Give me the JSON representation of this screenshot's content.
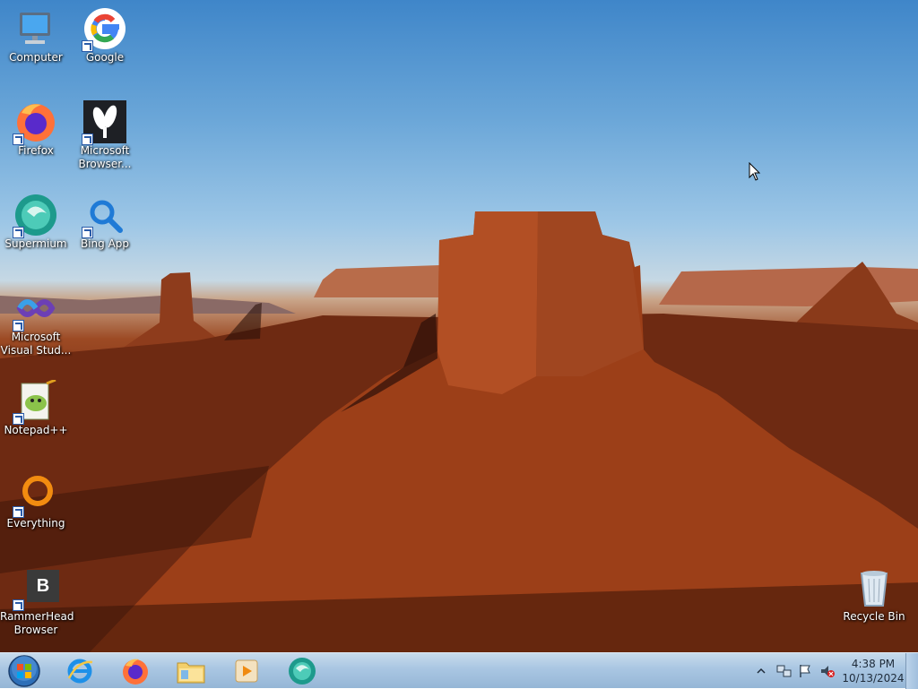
{
  "desktop": {
    "icons": [
      {
        "label": "Computer",
        "icon": "computer-icon"
      },
      {
        "label": "Google",
        "icon": "google-icon"
      },
      {
        "label": "Firefox",
        "icon": "firefox-icon"
      },
      {
        "label": "Microsoft Browser...",
        "icon": "microsoft-browser-icon"
      },
      {
        "label": "Supermium",
        "icon": "supermium-icon"
      },
      {
        "label": "Bing App",
        "icon": "bing-app-icon"
      },
      {
        "label": "Microsoft Visual Stud...",
        "icon": "visual-studio-icon"
      },
      {
        "label": "Notepad++",
        "icon": "notepadpp-icon"
      },
      {
        "label": "Everything",
        "icon": "everything-icon"
      },
      {
        "label": "RammerHead Browser",
        "icon": "rammerhead-icon"
      },
      {
        "label": "Recycle Bin",
        "icon": "recycle-bin-icon"
      }
    ],
    "rammerhead_letter": "B"
  },
  "taskbar": {
    "pinned": [
      {
        "name": "Internet Explorer",
        "icon": "ie-icon"
      },
      {
        "name": "Firefox",
        "icon": "firefox-icon"
      },
      {
        "name": "Windows Explorer",
        "icon": "folder-icon"
      },
      {
        "name": "Media Player",
        "icon": "media-player-icon"
      },
      {
        "name": "Supermium",
        "icon": "supermium-icon"
      }
    ],
    "tray": {
      "icons": [
        "show-hidden-icon",
        "network-icon",
        "action-center-flag-icon",
        "volume-muted-icon"
      ]
    },
    "clock": {
      "time": "4:38 PM",
      "date": "10/13/2024"
    }
  },
  "colors": {
    "taskbar": "#a9c6e2",
    "sky": "#6aa6d8",
    "rock": "#9c4a24"
  }
}
